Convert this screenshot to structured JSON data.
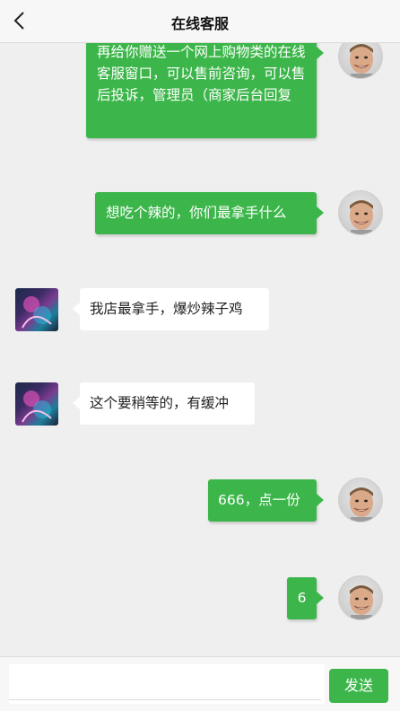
{
  "header": {
    "title": "在线客服",
    "back_icon": "chevron-left-icon"
  },
  "messages": [
    {
      "side": "out",
      "text": "再给你赠送一个网上购物类的在线客服窗口，可以售前咨询，可以售后投诉，管理员（商家后台回复"
    },
    {
      "side": "out",
      "text": "想吃个辣的，你们最拿手什么"
    },
    {
      "side": "in",
      "text": "我店最拿手，爆炒辣子鸡"
    },
    {
      "side": "in",
      "text": "这个要稍等的，有缓冲"
    },
    {
      "side": "out",
      "text": "666，点一份"
    },
    {
      "side": "out",
      "text": "6"
    }
  ],
  "footer": {
    "send_label": "发送",
    "input_value": ""
  },
  "colors": {
    "accent": "#3cb64a",
    "background": "#efefef"
  }
}
